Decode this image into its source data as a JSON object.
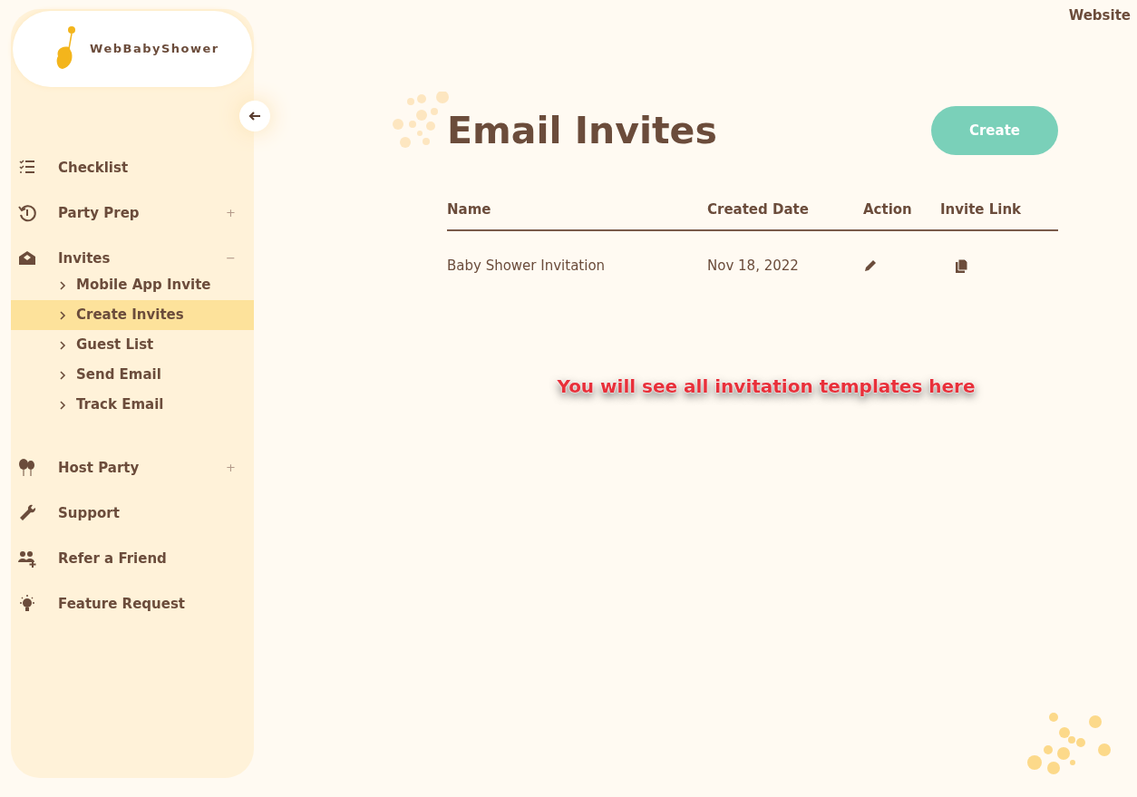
{
  "header": {
    "link": "Website"
  },
  "sidebar": {
    "logo_text": "WebBabyShower",
    "items": [
      {
        "label": "Checklist"
      },
      {
        "label": "Party Prep",
        "toggle": "+"
      },
      {
        "label": "Invites",
        "toggle": "−",
        "children": [
          {
            "label": "Mobile App Invite",
            "selected": false
          },
          {
            "label": "Create Invites",
            "selected": true
          },
          {
            "label": "Guest List",
            "selected": false
          },
          {
            "label": "Send Email",
            "selected": false
          },
          {
            "label": "Track Email",
            "selected": false
          }
        ]
      },
      {
        "label": "Host Party",
        "toggle": "+"
      },
      {
        "label": "Support"
      },
      {
        "label": "Refer a Friend"
      },
      {
        "label": "Feature Request"
      }
    ]
  },
  "main": {
    "title": "Email Invites",
    "create_button": "Create",
    "table": {
      "columns": [
        "Name",
        "Created Date",
        "Action",
        "Invite Link"
      ],
      "rows": [
        {
          "name": "Baby Shower Invitation",
          "created": "Nov 18, 2022"
        }
      ]
    },
    "callout": "You will see all invitation templates here"
  }
}
